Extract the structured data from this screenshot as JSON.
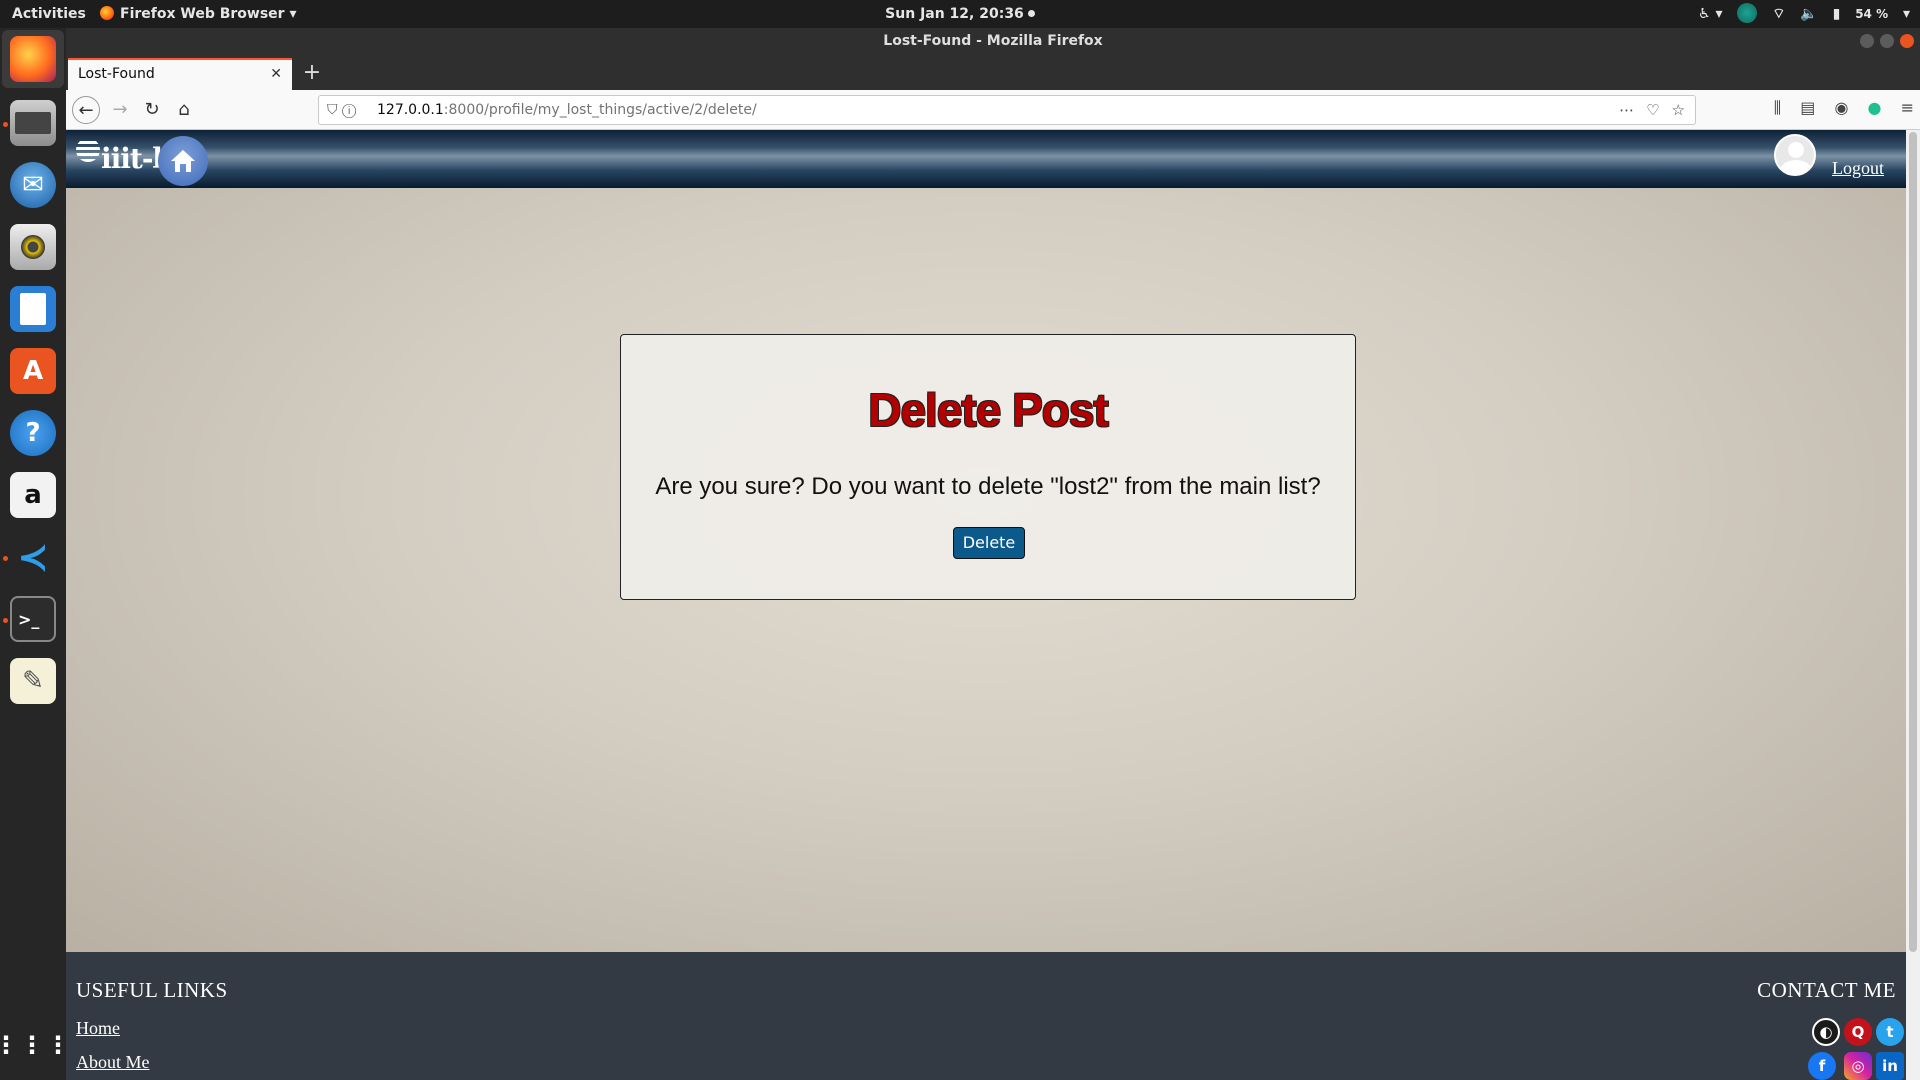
{
  "topbar": {
    "activities": "Activities",
    "app_menu": "Firefox Web Browser ▾",
    "clock": "Sun Jan 12, 20:36",
    "battery": "54 %"
  },
  "window": {
    "title": "Lost-Found - Mozilla Firefox",
    "tab_title": "Lost-Found",
    "url_host": "127.0.0.1",
    "url_rest": ":8000/profile/my_lost_things/active/2/delete/"
  },
  "site": {
    "logo_text": "iiit-b",
    "logout": "Logout"
  },
  "card": {
    "title": "Delete Post",
    "question": "Are you sure? Do you want to delete \"lost2\" from the main list?",
    "delete_label": "Delete"
  },
  "footer": {
    "links_title": "USEFUL LINKS",
    "home": "Home",
    "about": "About Me",
    "contact_title": "CONTACT ME"
  },
  "colors": {
    "title_red": "#b30000",
    "button_blue": "#0c5a8c",
    "footer_bg": "#343a44",
    "tab_accent": "#ff5733"
  },
  "icons": {
    "dock": [
      "firefox-icon",
      "files-icon",
      "thunderbird-icon",
      "rhythmbox-icon",
      "writer-icon",
      "software-icon",
      "help-icon",
      "amazon-icon",
      "vscode-icon",
      "terminal-icon",
      "text-editor-icon",
      "app-grid-icon"
    ],
    "social": [
      "github-icon",
      "quora-icon",
      "twitter-icon",
      "facebook-icon",
      "instagram-icon",
      "linkedin-icon"
    ]
  }
}
